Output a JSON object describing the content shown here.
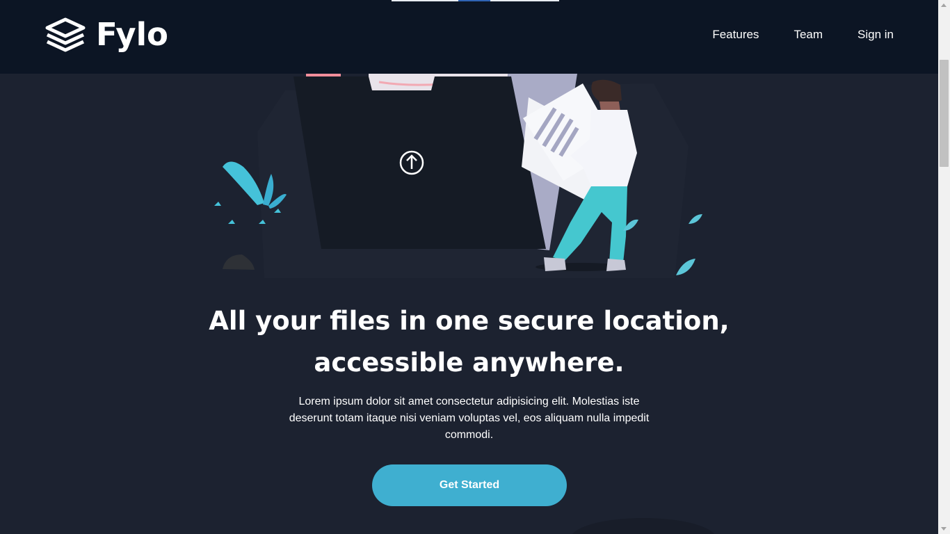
{
  "header": {
    "brand_name": "Fylo",
    "logo_icon": "stacked-layers-icon",
    "nav": [
      {
        "label": "Features"
      },
      {
        "label": "Team"
      },
      {
        "label": "Sign in"
      }
    ]
  },
  "hero": {
    "upload_icon": "arrow-up-circle-icon",
    "headline_line1": "All your files in one secure location,",
    "headline_line2": "accessible anywhere.",
    "description": "Lorem ipsum dolor sit amet consectetur adipisicing elit. Molestias iste deserunt totam itaque nisi veniam voluptas vel, eos aliquam nulla impedit commodi.",
    "cta_label": "Get Started"
  },
  "colors": {
    "background": "#1c2230",
    "header_background": "#0c1524",
    "accent": "#3fafd0",
    "text": "#ffffff"
  }
}
